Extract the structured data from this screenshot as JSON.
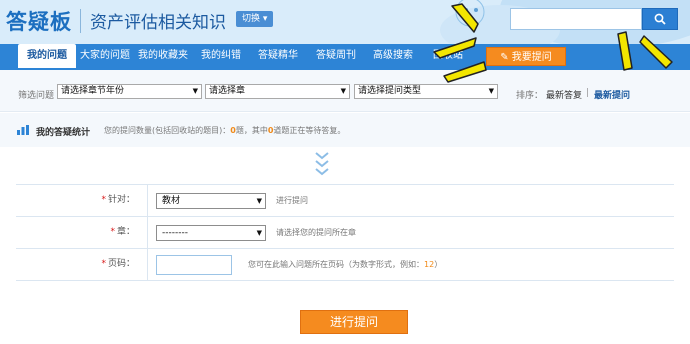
{
  "header": {
    "logo": "答疑板",
    "subject": "资产评估相关知识",
    "switch_label": "切换",
    "search_placeholder": ""
  },
  "nav": {
    "items": [
      {
        "label": "我的问题",
        "active": true
      },
      {
        "label": "大家的问题"
      },
      {
        "label": "我的收藏夹"
      },
      {
        "label": "我的纠错"
      },
      {
        "label": "答疑精华"
      },
      {
        "label": "答疑周刊"
      },
      {
        "label": "高级搜索"
      },
      {
        "label": "回收站"
      }
    ],
    "ask_label": "我要提问"
  },
  "filter": {
    "label": "筛选问题",
    "selects": [
      "请选择章节年份",
      "请选择章",
      "请选择提问类型"
    ],
    "sort_label": "排序：",
    "sort_latest_answer": "最新答复",
    "sort_sep": "|",
    "sort_latest_question": "最新提问"
  },
  "stats": {
    "title": "我的答疑统计",
    "text_prefix": "您的提问数量(包括回收站的题目)：",
    "question_count": "0",
    "text_mid": "题，其中",
    "pending_count": "0",
    "text_suffix": "道题正在等待答复。"
  },
  "form": {
    "rows": [
      {
        "label": "针对：",
        "value": "教材",
        "hint": "进行提问"
      },
      {
        "label": "章：",
        "value": "--------",
        "hint": "请选择您的提问所在章"
      },
      {
        "label": "页码：",
        "value": "",
        "hint_prefix": "您可在此输入问题所在页码（为数字形式，例如：",
        "hint_example": "12",
        "hint_suffix": "）"
      }
    ],
    "submit_label": "进行提问"
  },
  "colors": {
    "primary": "#2d84d6",
    "accent": "#f58b1f",
    "logo": "#1c6fc0",
    "callout": "#f3e600"
  }
}
